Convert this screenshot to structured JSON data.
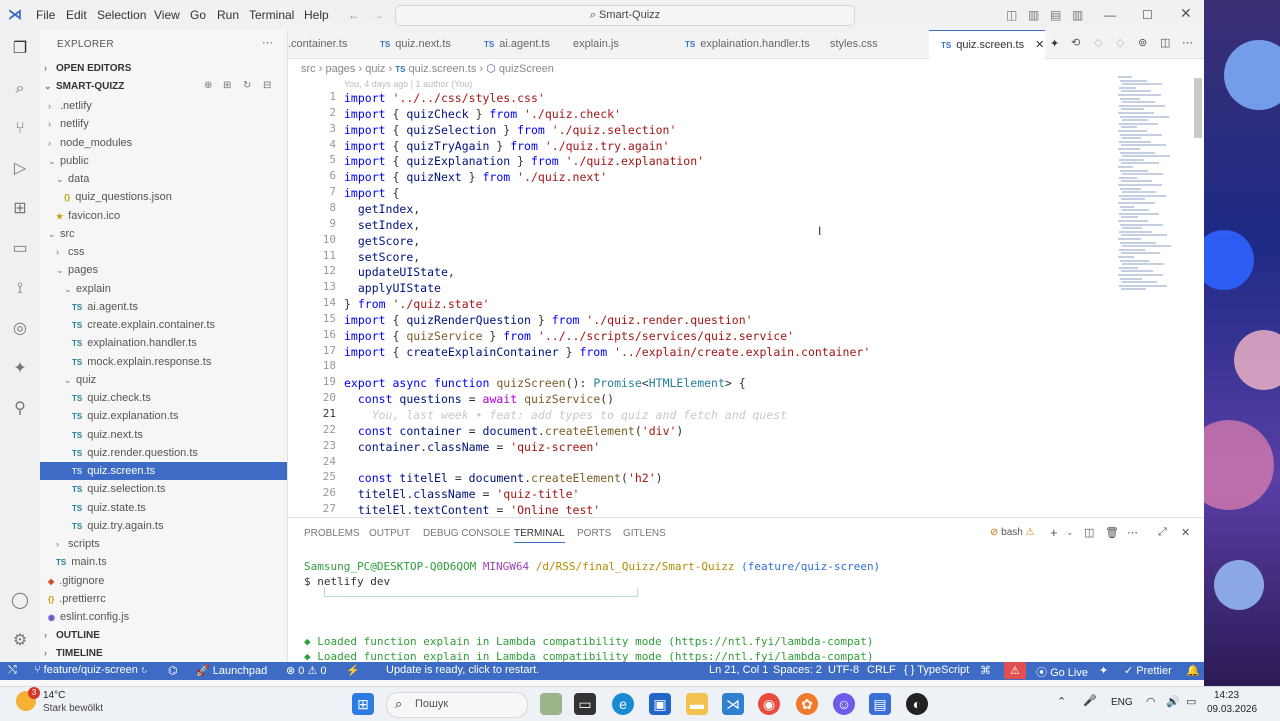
{
  "menu": [
    "File",
    "Edit",
    "Selection",
    "View",
    "Go",
    "Run",
    "Terminal",
    "Help"
  ],
  "command_center": "Smart-Quizz",
  "sidebar": {
    "header": "EXPLORER",
    "open_editors": "OPEN EDITORS",
    "project": "SMART-QUIZZ",
    "tree": [
      {
        "label": ".netlify",
        "depth": 1,
        "kind": "folder",
        "chev": "›"
      },
      {
        "label": "netlify",
        "depth": 1,
        "kind": "folder",
        "chev": "›"
      },
      {
        "label": "node_modules",
        "depth": 1,
        "kind": "folder",
        "chev": "›"
      },
      {
        "label": "public",
        "depth": 1,
        "kind": "folder",
        "chev": "⌄"
      },
      {
        "label": "data",
        "depth": 2,
        "kind": "folder",
        "chev": "⌄"
      },
      {
        "label": "quiz_questions.json",
        "depth": 3,
        "kind": "json"
      },
      {
        "label": "favicon.ico",
        "depth": 2,
        "kind": "ico"
      },
      {
        "label": "src",
        "depth": 1,
        "kind": "folder",
        "chev": "⌄"
      },
      {
        "label": "css",
        "depth": 2,
        "kind": "folder",
        "chev": "›"
      },
      {
        "label": "pages",
        "depth": 2,
        "kind": "folder",
        "chev": "⌄"
      },
      {
        "label": "explain",
        "depth": 3,
        "kind": "folder",
        "chev": "⌄"
      },
      {
        "label": "ai.agent.ts",
        "depth": 4,
        "kind": "ts"
      },
      {
        "label": "create.explain.container.ts",
        "depth": 4,
        "kind": "ts"
      },
      {
        "label": "explaination.handler.ts",
        "depth": 4,
        "kind": "ts"
      },
      {
        "label": "mock.explain.response.ts",
        "depth": 4,
        "kind": "ts"
      },
      {
        "label": "quiz",
        "depth": 3,
        "kind": "folder",
        "chev": "⌄"
      },
      {
        "label": "quiz.check.ts",
        "depth": 4,
        "kind": "ts"
      },
      {
        "label": "quiz.explanation.ts",
        "depth": 4,
        "kind": "ts"
      },
      {
        "label": "quiz.next.ts",
        "depth": 4,
        "kind": "ts"
      },
      {
        "label": "quiz.render.question.ts",
        "depth": 4,
        "kind": "ts"
      },
      {
        "label": "quiz.screen.ts",
        "depth": 4,
        "kind": "ts",
        "selected": true
      },
      {
        "label": "quiz.selection.ts",
        "depth": 4,
        "kind": "ts"
      },
      {
        "label": "quiz.state.ts",
        "depth": 4,
        "kind": "ts"
      },
      {
        "label": "quiz.try.again.ts",
        "depth": 4,
        "kind": "ts"
      },
      {
        "label": "scripts",
        "depth": 2,
        "kind": "folder",
        "chev": "›"
      },
      {
        "label": "main.ts",
        "depth": 2,
        "kind": "ts"
      },
      {
        "label": ".gitignore",
        "depth": 1,
        "kind": "git"
      },
      {
        "label": ".prettierrc",
        "depth": 1,
        "kind": "json"
      },
      {
        "label": "eslint.config.js",
        "depth": 1,
        "kind": "eslint"
      }
    ],
    "outline": "OUTLINE",
    "timeline": "TIMELINE"
  },
  "tabs": [
    {
      "label": ".container.ts",
      "ts": false
    },
    {
      "label": "quiz.next.ts",
      "ts": true
    },
    {
      "label": "ai.agent.ts",
      "ts": true
    },
    {
      "label": "explain.js",
      "ts": false
    },
    {
      "label": "explaination.handler.ts",
      "ts": true
    },
    {
      "label": "styles.css",
      "ts": false
    },
    {
      "label": "quiz.screen.ts",
      "ts": true,
      "active": true
    }
  ],
  "breadcrumb": [
    "src",
    "pages",
    "quiz",
    "quiz.screen.ts",
    "quizScreen"
  ],
  "blame": "You, 4 days ago | 1 author (You)",
  "code": [
    {
      "n": "1",
      "t": "import '../../css/styles.css'"
    },
    {
      "n": "2",
      "t": "import { quizCheck } from './quiz.check'"
    },
    {
      "n": "3",
      "t": "import { quizSelection } from './quiz.selection'"
    },
    {
      "n": "4",
      "t": "import { quizTryAgain } from './quiz.try.again'"
    },
    {
      "n": "5",
      "t": "import { quizExplanation } from './quiz.explanation'"
    },
    {
      "n": "6",
      "t": "import { quizNext } from './quiz.next'"
    },
    {
      "n": "7",
      "t": "import {"
    },
    {
      "n": "8",
      "t": "  getIndex,"
    },
    {
      "n": "9",
      "t": "  setIndex,"
    },
    {
      "n": "10",
      "t": "  getScore,"
    },
    {
      "n": "11",
      "t": "  setScore,"
    },
    {
      "n": "12",
      "t": "  updateUIState,"
    },
    {
      "n": "13",
      "t": "  applyUIState"
    },
    {
      "n": "14",
      "t": "} from './quiz.state'"
    },
    {
      "n": "15",
      "t": "import { quizRenderQuestion } from './quiz.render.question'"
    },
    {
      "n": "16",
      "t": "import { quizService } from '../../scripts/services/quiz.service'"
    },
    {
      "n": "17",
      "t": "import { createExplainContainer } from '../explain/create.explain.container'"
    },
    {
      "n": "18",
      "t": ""
    },
    {
      "n": "19",
      "t": "export async function quizScreen(): Promise<HTMLElement> {"
    },
    {
      "n": "20",
      "t": "  const questions = await quizService()"
    },
    {
      "n": "21",
      "t": "    You, last week • feat: add types to quiz and fetch and quest",
      "ghost": true
    },
    {
      "n": "22",
      "t": "  const container = document.createElement('div')"
    },
    {
      "n": "23",
      "t": "  container.className = 'quiz-screen'"
    },
    {
      "n": "24",
      "t": ""
    },
    {
      "n": "25",
      "t": "  const titelEl = document.createElement('h2')"
    },
    {
      "n": "26",
      "t": "  titelEl.className = 'quiz-title'"
    },
    {
      "n": "27",
      "t": "  titelEl.textContent = 'Online test'"
    }
  ],
  "panel": {
    "tabs": [
      "PROBLEMS",
      "OUTPUT",
      "DEBUG CONSOLE",
      "TERMINAL",
      "PORTS",
      "GITLENS"
    ],
    "active": "TERMINAL",
    "shell": "bash",
    "prompt_user": "Samsung_PC@DESKTOP-Q0D6QOM",
    "prompt_env": "MINGW64",
    "prompt_path": "/d/RSS/final_Quizz/Smart-Quizz",
    "prompt_branch": "(feature/quiz-screen)",
    "command": "$ netlify dev",
    "lines": [
      "◆ Loaded function explain in Lambda compatibility mode (https://ntl.fyi/lambda-compat)",
      "◆ Loaded function explain in Lambda compatibility mode (https://ntl.fyi/lambda-compat)"
    ]
  },
  "status": {
    "branch": "feature/quiz-screen",
    "launchpad": "Launchpad",
    "problems": "⊗ 0 ⚠ 0",
    "update": "Update is ready, click to restart.",
    "position": "Ln 21, Col 1",
    "spaces": "Spaces: 2",
    "encoding": "UTF-8",
    "eol": "CRLF",
    "language": "{ } TypeScript",
    "golive": "Go Live",
    "prettier": "Prettier"
  },
  "taskbar": {
    "badge": "3",
    "temp": "14°C",
    "weather": "Stark bewölkt",
    "search": "Пошук",
    "lang": "ENG",
    "time": "14:23",
    "date": "09.03.2026"
  },
  "colors": {
    "accent": "#3e6cc5",
    "keyword": "#0000ff",
    "control": "#af00db",
    "string": "#a31515",
    "variable": "#001080",
    "function": "#795e26",
    "type": "#267f99",
    "term_green": "#2e9e3a",
    "term_blue": "#2f6fd6",
    "term_yellow": "#b38a00"
  }
}
